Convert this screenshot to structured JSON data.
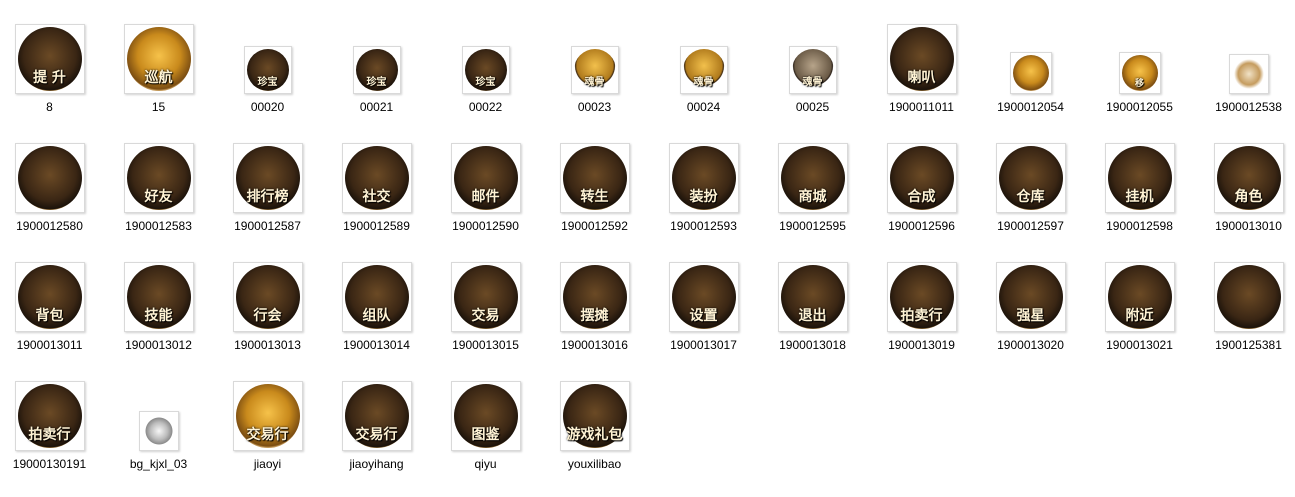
{
  "items": [
    {
      "name": "8",
      "caption": "提 升",
      "icon": "medal",
      "size": "big"
    },
    {
      "name": "15",
      "caption": "巡航",
      "icon": "gold",
      "size": "big"
    },
    {
      "name": "00020",
      "caption": "珍宝",
      "icon": "medal",
      "size": "mid"
    },
    {
      "name": "00021",
      "caption": "珍宝",
      "icon": "medal",
      "size": "mid"
    },
    {
      "name": "00022",
      "caption": "珍宝",
      "icon": "medal",
      "size": "mid"
    },
    {
      "name": "00023",
      "caption": "魂骨",
      "icon": "skull",
      "size": "mid"
    },
    {
      "name": "00024",
      "caption": "魂骨",
      "icon": "skull",
      "size": "mid"
    },
    {
      "name": "00025",
      "caption": "魂骨",
      "icon": "skull dark",
      "size": "mid"
    },
    {
      "name": "1900011011",
      "caption": "喇叭",
      "icon": "medal",
      "size": "big"
    },
    {
      "name": "1900012054",
      "caption": "",
      "icon": "gold",
      "size": "small"
    },
    {
      "name": "1900012055",
      "caption": "移",
      "icon": "gold",
      "size": "small"
    },
    {
      "name": "1900012538",
      "caption": "",
      "icon": "star",
      "size": "tiny"
    },
    {
      "name": "1900012580",
      "caption": "",
      "icon": "medal",
      "size": "big"
    },
    {
      "name": "1900012583",
      "caption": "好友",
      "icon": "medal",
      "size": "big"
    },
    {
      "name": "1900012587",
      "caption": "排行榜",
      "icon": "medal",
      "size": "big"
    },
    {
      "name": "1900012589",
      "caption": "社交",
      "icon": "medal",
      "size": "big"
    },
    {
      "name": "1900012590",
      "caption": "邮件",
      "icon": "medal",
      "size": "big"
    },
    {
      "name": "1900012592",
      "caption": "转生",
      "icon": "medal",
      "size": "big"
    },
    {
      "name": "1900012593",
      "caption": "装扮",
      "icon": "medal",
      "size": "big"
    },
    {
      "name": "1900012595",
      "caption": "商城",
      "icon": "medal",
      "size": "big"
    },
    {
      "name": "1900012596",
      "caption": "合成",
      "icon": "medal",
      "size": "big"
    },
    {
      "name": "1900012597",
      "caption": "仓库",
      "icon": "medal",
      "size": "big"
    },
    {
      "name": "1900012598",
      "caption": "挂机",
      "icon": "medal",
      "size": "big"
    },
    {
      "name": "1900013010",
      "caption": "角色",
      "icon": "medal",
      "size": "big"
    },
    {
      "name": "1900013011",
      "caption": "背包",
      "icon": "medal",
      "size": "big"
    },
    {
      "name": "1900013012",
      "caption": "技能",
      "icon": "medal",
      "size": "big"
    },
    {
      "name": "1900013013",
      "caption": "行会",
      "icon": "medal",
      "size": "big"
    },
    {
      "name": "1900013014",
      "caption": "组队",
      "icon": "medal",
      "size": "big"
    },
    {
      "name": "1900013015",
      "caption": "交易",
      "icon": "medal",
      "size": "big"
    },
    {
      "name": "1900013016",
      "caption": "摆摊",
      "icon": "medal",
      "size": "big"
    },
    {
      "name": "1900013017",
      "caption": "设置",
      "icon": "medal",
      "size": "big"
    },
    {
      "name": "1900013018",
      "caption": "退出",
      "icon": "medal",
      "size": "big"
    },
    {
      "name": "1900013019",
      "caption": "拍卖行",
      "icon": "medal",
      "size": "big"
    },
    {
      "name": "1900013020",
      "caption": "强星",
      "icon": "medal",
      "size": "big"
    },
    {
      "name": "1900013021",
      "caption": "附近",
      "icon": "medal",
      "size": "big"
    },
    {
      "name": "1900125381",
      "caption": "",
      "icon": "medal",
      "size": "big"
    },
    {
      "name": "19000130191",
      "caption": "拍卖行",
      "icon": "medal",
      "size": "big"
    },
    {
      "name": "bg_kjxl_03",
      "caption": "",
      "icon": "gear",
      "size": "tiny"
    },
    {
      "name": "jiaoyi",
      "caption": "交易行",
      "icon": "gold",
      "size": "big"
    },
    {
      "name": "jiaoyihang",
      "caption": "交易行",
      "icon": "medal",
      "size": "big"
    },
    {
      "name": "qiyu",
      "caption": "图鉴",
      "icon": "medal",
      "size": "big"
    },
    {
      "name": "youxilibao",
      "caption": "游戏礼包",
      "icon": "medal",
      "size": "big"
    }
  ]
}
